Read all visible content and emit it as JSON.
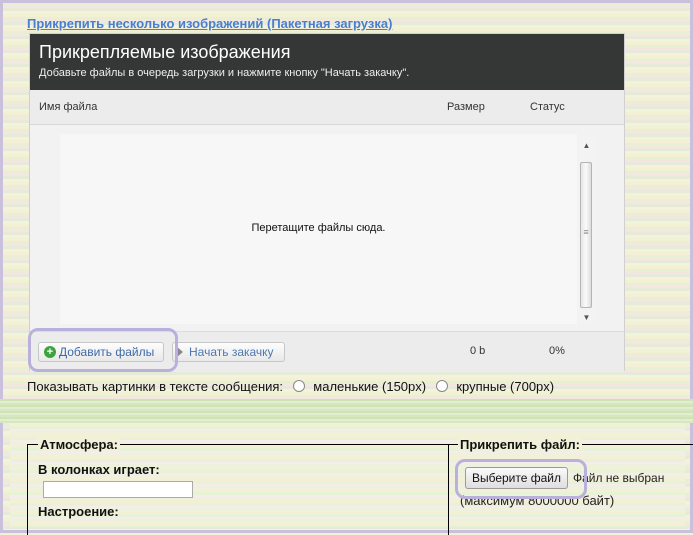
{
  "batch_link": "Прикрепить несколько изображений (Пакетная загрузка)",
  "uploader": {
    "title": "Прикрепляемые изображения",
    "subtitle": "Добавьте файлы в очередь загрузки и нажмите кнопку \"Начать закачку\".",
    "columns": {
      "name": "Имя файла",
      "size": "Размер",
      "status": "Статус"
    },
    "drop_text": "Перетащите файлы сюда.",
    "add_button": "Добавить файлы",
    "start_button": "Начать закачку",
    "total_size": "0 b",
    "total_percent": "0%"
  },
  "image_options": {
    "label": "Показывать картинки в тексте сообщения:",
    "small": "маленькие (150px)",
    "large": "крупные (700px)"
  },
  "atmosphere": {
    "legend": "Атмосфера:",
    "columns_label": "В колонках играет:",
    "columns_value": "",
    "mood_label": "Настроение:"
  },
  "attach": {
    "legend": "Прикрепить файл:",
    "choose_button": "Выберите файл",
    "no_file": "Файл не выбран",
    "max_size": "(максимум 8000000 байт)"
  }
}
